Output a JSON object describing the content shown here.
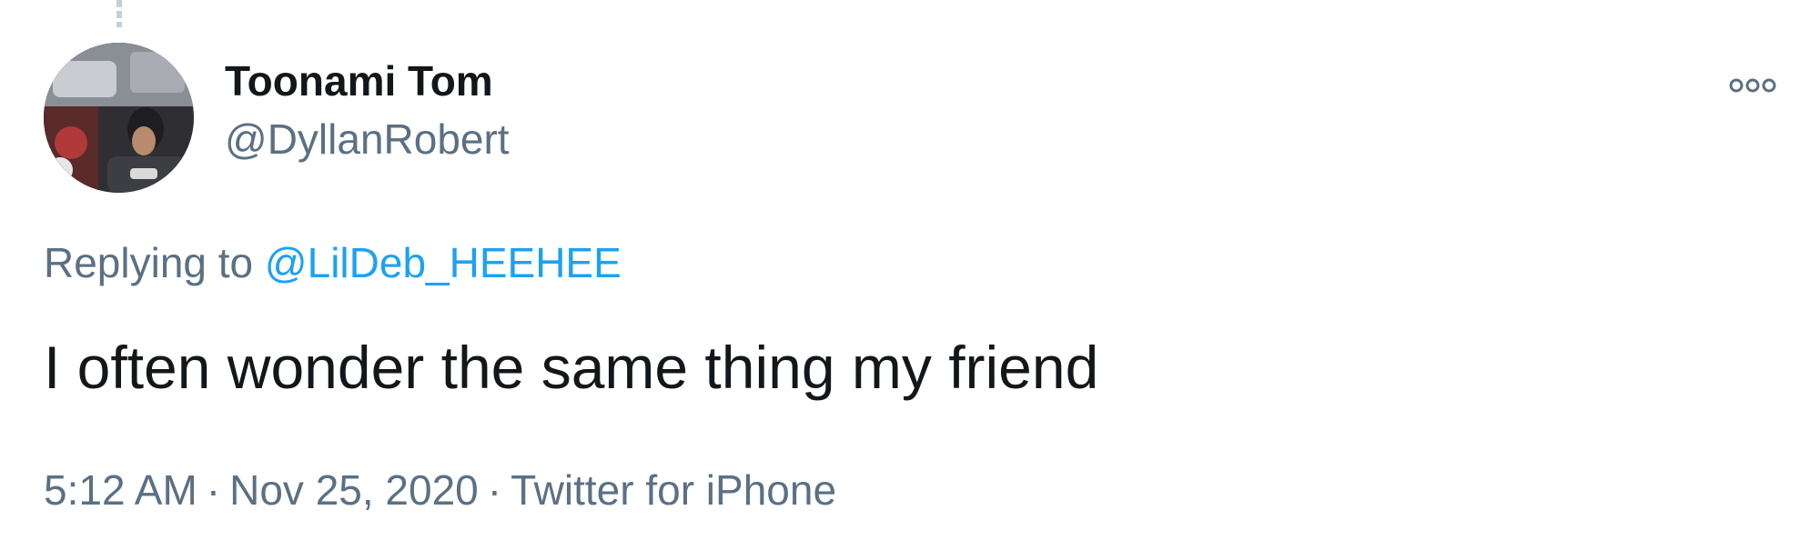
{
  "colors": {
    "text_primary": "#14171a",
    "text_secondary": "#5b7083",
    "link": "#1da1f2",
    "thread_line": "#c4cfd6",
    "background": "#ffffff"
  },
  "author": {
    "avatar_icon": "profile-photo",
    "display_name": "Toonami Tom",
    "handle": "@DyllanRobert"
  },
  "actions": {
    "more_icon": "more-options-icon"
  },
  "reply": {
    "prefix": "Replying to",
    "target": "@LilDeb_HEEHEE"
  },
  "tweet": {
    "text": "I often wonder the same thing my friend"
  },
  "meta": {
    "time": "5:12 AM",
    "separator": "·",
    "date": "Nov 25, 2020",
    "source": "Twitter for iPhone"
  }
}
